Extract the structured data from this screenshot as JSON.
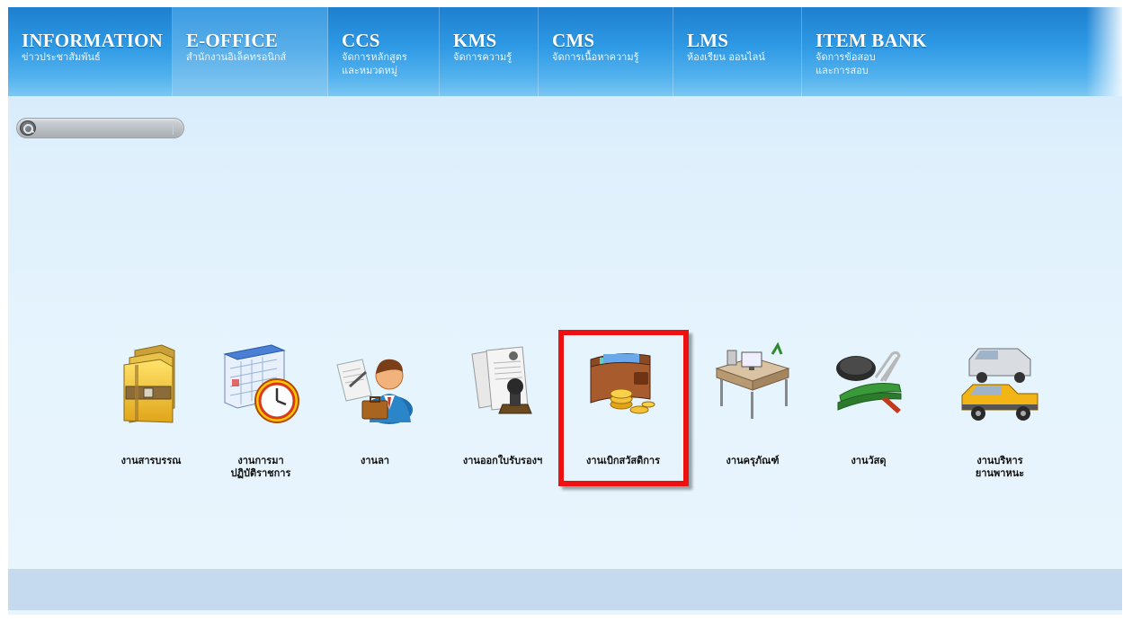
{
  "nav": {
    "items": [
      {
        "title": "INFORMATION",
        "sub": "ข่าวประชาสัมพันธ์"
      },
      {
        "title": "E-OFFICE",
        "sub": "สำนักงานอิเล็คทรอนิกส์"
      },
      {
        "title": "CCS",
        "sub": "จัดการหลักสูตร\nและหมวดหมู่"
      },
      {
        "title": "KMS",
        "sub": "จัดการความรู้"
      },
      {
        "title": "CMS",
        "sub": "จัดการเนื้อหาความรู้"
      },
      {
        "title": "LMS",
        "sub": "ห้องเรียน ออนไลน์"
      },
      {
        "title": "ITEM BANK",
        "sub": "จัดการข้อสอบ\nและการสอบ"
      }
    ],
    "active_index": 1
  },
  "search": {
    "value": "",
    "placeholder": ""
  },
  "modules": [
    {
      "label": "งานสารบรรณ",
      "icon": "folder-archive-icon"
    },
    {
      "label": "งานการมา\nปฏิบัติราชการ",
      "icon": "calendar-clock-icon"
    },
    {
      "label": "งานลา",
      "icon": "businessman-briefcase-icon"
    },
    {
      "label": "งานออกใบรับรองฯ",
      "icon": "certificate-stamp-icon"
    },
    {
      "label": "งานเบิกสวัสดิการ",
      "icon": "wallet-coins-icon",
      "selected": true
    },
    {
      "label": "งานครุภัณฑ์",
      "icon": "office-desk-icon"
    },
    {
      "label": "งานวัสดุ",
      "icon": "stapler-supplies-icon"
    },
    {
      "label": "งานบริหาร\nยานพาหนะ",
      "icon": "vehicles-icon"
    }
  ],
  "colors": {
    "nav_gradient_top": "#1d7fcf",
    "nav_gradient_bottom": "#7cc7f2",
    "page_background": "#dff0fc",
    "highlight": "#ee1111",
    "footer": "#c5d9ef"
  }
}
